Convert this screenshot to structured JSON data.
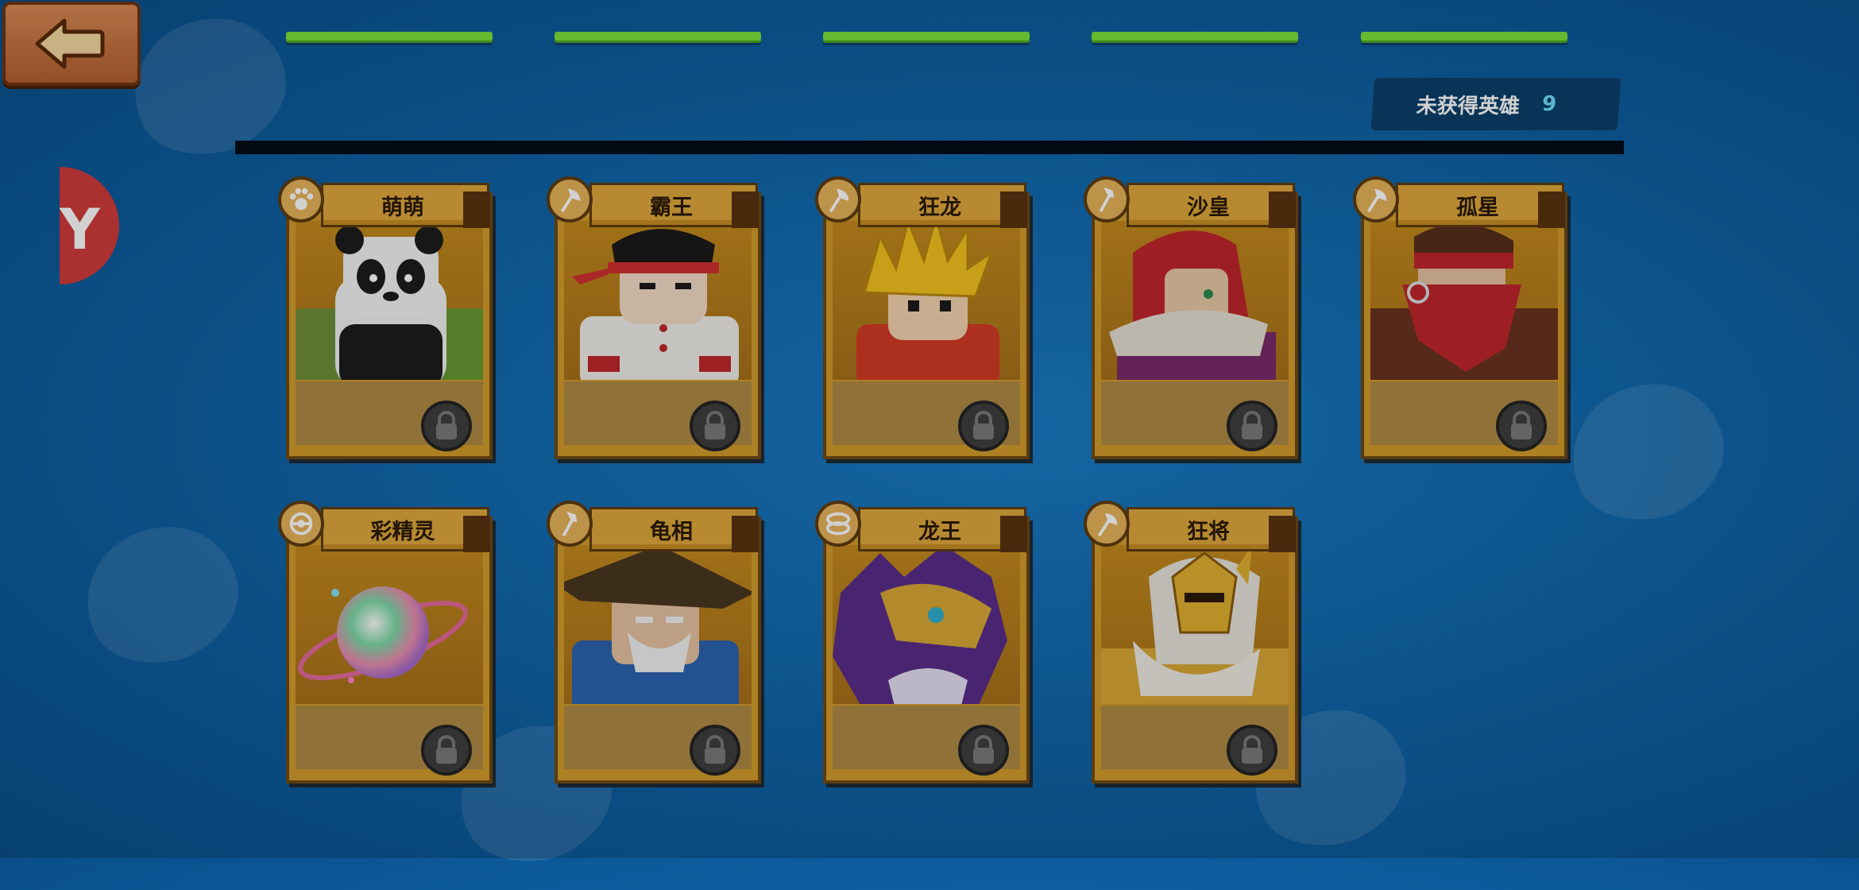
{
  "screen": "hero-collection",
  "back_button": {
    "icon": "arrow-left-icon"
  },
  "unowned_panel": {
    "label": "未获得英雄",
    "count": "9"
  },
  "side_tab": {
    "icon": "y-logo-icon",
    "color": "#d13b3b"
  },
  "colors": {
    "accent_green": "#7be23a",
    "card_gold": "#d29d2b",
    "background": "#1a7cc6"
  },
  "heroes": [
    {
      "name": "萌萌",
      "role_icon": "paw-icon",
      "portrait": "panda",
      "locked": true
    },
    {
      "name": "霸王",
      "role_icon": "axe-icon",
      "portrait": "fighter-red-headband",
      "locked": true
    },
    {
      "name": "狂龙",
      "role_icon": "axe-icon",
      "portrait": "spiky-gold-hair",
      "locked": true
    },
    {
      "name": "沙皇",
      "role_icon": "staff-icon",
      "portrait": "red-hood",
      "locked": true
    },
    {
      "name": "孤星",
      "role_icon": "axe-icon",
      "portrait": "masked-bandit",
      "locked": true
    },
    {
      "name": "彩精灵",
      "role_icon": "orb-icon",
      "portrait": "rainbow-orb",
      "locked": true
    },
    {
      "name": "龟相",
      "role_icon": "staff-icon",
      "portrait": "straw-hat-elder",
      "locked": true
    },
    {
      "name": "龙王",
      "role_icon": "ring-icon",
      "portrait": "purple-dragon",
      "locked": true
    },
    {
      "name": "狂将",
      "role_icon": "axe-icon",
      "portrait": "gold-helmet-knight",
      "locked": true
    }
  ]
}
